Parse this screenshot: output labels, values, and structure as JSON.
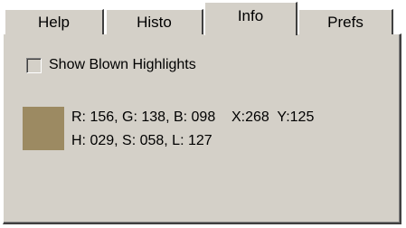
{
  "tabs": [
    {
      "label": "Help"
    },
    {
      "label": "Histo"
    },
    {
      "label": "Info",
      "active": true
    },
    {
      "label": "Prefs"
    }
  ],
  "options": {
    "show_blown_highlights_label": "Show Blown Highlights",
    "show_blown_highlights_checked": false
  },
  "color_info": {
    "swatch_color": "#9c8a62",
    "rgb_line": "R: 156, G: 138, B: 098    X:268  Y:125",
    "hsl_line": "H: 029, S: 058, L: 127"
  },
  "colors": {
    "panel_bg": "#d4d0c8",
    "border_dark": "#404040",
    "border_light": "#ffffff"
  }
}
